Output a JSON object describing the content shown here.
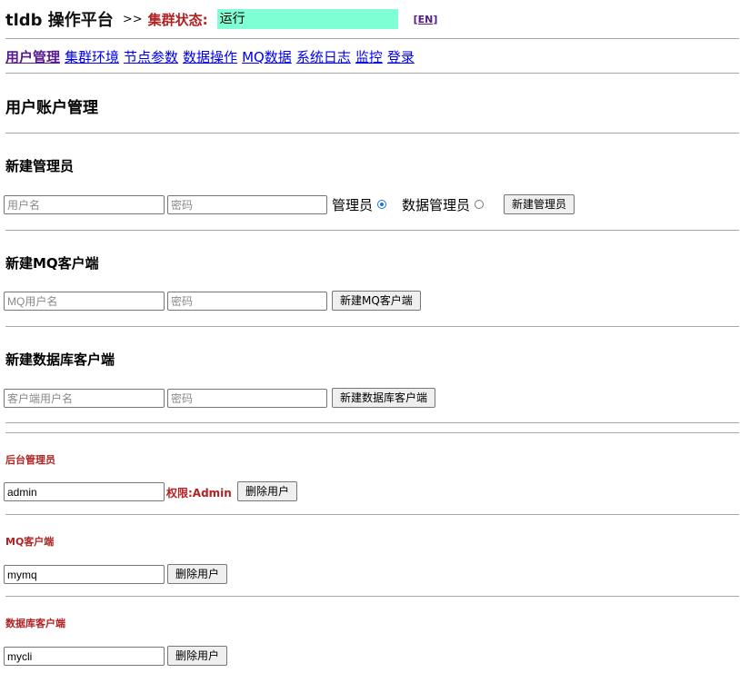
{
  "header": {
    "app_title": "tldb 操作平台",
    "separator": ">>",
    "cluster_label": "集群状态:",
    "cluster_status": "运行",
    "cluster_status_color": "#7fffd4",
    "lang_link": "[EN]"
  },
  "nav": {
    "items": [
      {
        "label": "用户管理",
        "active": true
      },
      {
        "label": "集群环境"
      },
      {
        "label": "节点参数"
      },
      {
        "label": "数据操作"
      },
      {
        "label": "MQ数据"
      },
      {
        "label": "系统日志"
      },
      {
        "label": "监控"
      },
      {
        "label": "登录"
      }
    ]
  },
  "page_title": "用户账户管理",
  "new_admin": {
    "title": "新建管理员",
    "username_placeholder": "用户名",
    "password_placeholder": "密码",
    "role_admin_label": "管理员",
    "role_data_admin_label": "数据管理员",
    "selected_role": "管理员",
    "submit_label": "新建管理员"
  },
  "new_mq_client": {
    "title": "新建MQ客户端",
    "username_placeholder": "MQ用户名",
    "password_placeholder": "密码",
    "submit_label": "新建MQ客户端"
  },
  "new_db_client": {
    "title": "新建数据库客户端",
    "username_placeholder": "客户端用户名",
    "password_placeholder": "密码",
    "submit_label": "新建数据库客户端"
  },
  "backend_admins": {
    "title": "后台管理员",
    "username": "admin",
    "permission": "权限:Admin",
    "delete_label": "删除用户"
  },
  "mq_clients": {
    "title": "MQ客户端",
    "username": "mymq",
    "delete_label": "删除用户"
  },
  "db_clients": {
    "title": "数据库客户端",
    "username": "mycli",
    "delete_label": "删除用户"
  },
  "colors": {
    "accent_red": "#b22222",
    "link_blue": "#0000ee",
    "visited_purple": "#551a8b",
    "radio_blue": "#1a73e8"
  }
}
